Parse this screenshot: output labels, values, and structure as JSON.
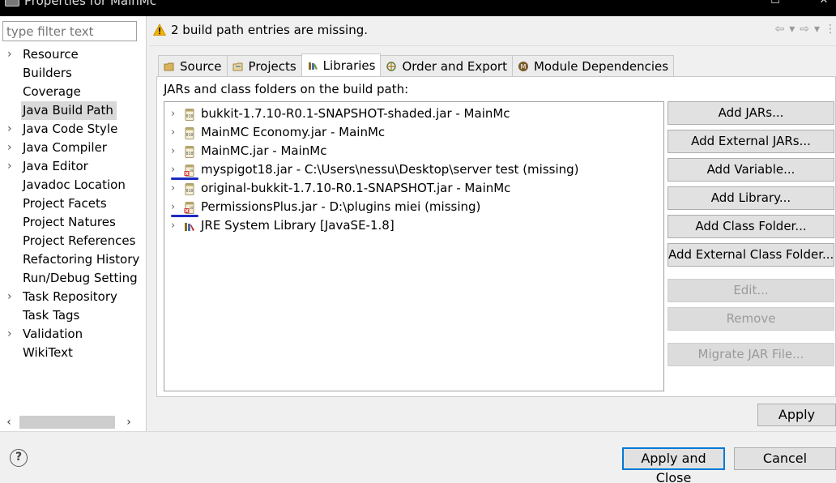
{
  "window": {
    "title": "Properties for MainMc"
  },
  "filter": {
    "placeholder": "type filter text"
  },
  "nav": [
    {
      "label": "Resource",
      "expandable": true
    },
    {
      "label": "Builders",
      "expandable": false
    },
    {
      "label": "Coverage",
      "expandable": false
    },
    {
      "label": "Java Build Path",
      "expandable": false,
      "selected": true
    },
    {
      "label": "Java Code Style",
      "expandable": true
    },
    {
      "label": "Java Compiler",
      "expandable": true
    },
    {
      "label": "Java Editor",
      "expandable": true
    },
    {
      "label": "Javadoc Location",
      "expandable": false
    },
    {
      "label": "Project Facets",
      "expandable": false
    },
    {
      "label": "Project Natures",
      "expandable": false
    },
    {
      "label": "Project References",
      "expandable": false
    },
    {
      "label": "Refactoring History",
      "expandable": false
    },
    {
      "label": "Run/Debug Setting",
      "expandable": false
    },
    {
      "label": "Task Repository",
      "expandable": true
    },
    {
      "label": "Task Tags",
      "expandable": false
    },
    {
      "label": "Validation",
      "expandable": true
    },
    {
      "label": "WikiText",
      "expandable": false
    }
  ],
  "message": {
    "text": "2 build path entries are missing."
  },
  "tabs": [
    {
      "label": "Source"
    },
    {
      "label": "Projects"
    },
    {
      "label": "Libraries",
      "active": true
    },
    {
      "label": "Order and Export"
    },
    {
      "label": "Module Dependencies"
    }
  ],
  "libraries": {
    "caption": "JARs and class folders on the build path:",
    "entries": [
      {
        "label": "bukkit-1.7.10-R0.1-SNAPSHOT-shaded.jar - MainMc",
        "missing": false
      },
      {
        "label": "MainMC Economy.jar - MainMc",
        "missing": false
      },
      {
        "label": "MainMC.jar - MainMc",
        "missing": false
      },
      {
        "label": "myspigot18.jar - C:\\Users\\nessu\\Desktop\\server test (missing)",
        "missing": true
      },
      {
        "label": "original-bukkit-1.7.10-R0.1-SNAPSHOT.jar - MainMc",
        "missing": false
      },
      {
        "label": "PermissionsPlus.jar - D:\\plugins miei (missing)",
        "missing": true
      },
      {
        "label": "JRE System Library [JavaSE-1.8]",
        "missing": false,
        "jre": true
      }
    ]
  },
  "buttons": {
    "add_jars": "Add JARs...",
    "add_external_jars": "Add External JARs...",
    "add_variable": "Add Variable...",
    "add_library": "Add Library...",
    "add_class_folder": "Add Class Folder...",
    "add_external_class_folder": "Add External Class Folder...",
    "edit": "Edit...",
    "remove": "Remove",
    "migrate_jar": "Migrate JAR File..."
  },
  "apply_label": "Apply",
  "footer": {
    "help": "?",
    "apply_and_close": "Apply and Close",
    "cancel": "Cancel"
  },
  "colors": {
    "accent": "#0078d7",
    "underline": "#1a2bc2",
    "warning": "#f2b400"
  }
}
